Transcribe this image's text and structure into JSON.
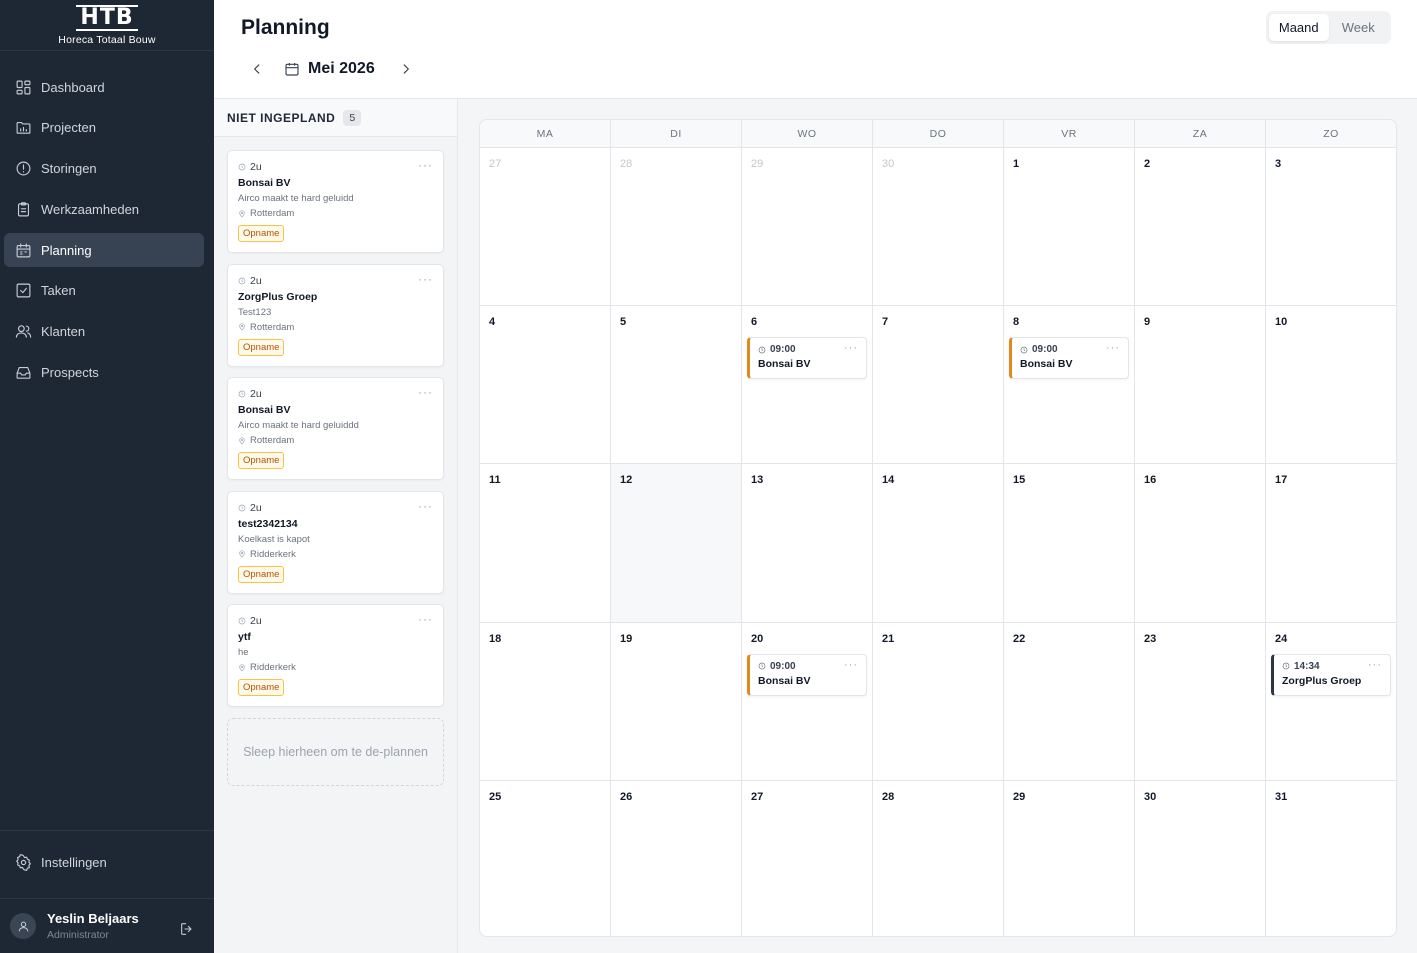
{
  "brand": {
    "mark": "HTB",
    "name": "Horeca Totaal Bouw"
  },
  "sidebar": {
    "items": [
      {
        "label": "Dashboard",
        "icon": "dashboard-icon"
      },
      {
        "label": "Projecten",
        "icon": "folder-chart-icon"
      },
      {
        "label": "Storingen",
        "icon": "alert-circle-icon"
      },
      {
        "label": "Werkzaamheden",
        "icon": "clipboard-icon"
      },
      {
        "label": "Planning",
        "icon": "calendar-icon",
        "active": true
      },
      {
        "label": "Taken",
        "icon": "checkbox-icon"
      },
      {
        "label": "Klanten",
        "icon": "users-icon"
      },
      {
        "label": "Prospects",
        "icon": "inbox-icon"
      }
    ],
    "settings_label": "Instellingen"
  },
  "user": {
    "name": "Yeslin Beljaars",
    "role": "Administrator"
  },
  "header": {
    "title": "Planning",
    "month": "Mei 2026",
    "views": [
      "Maand",
      "Week"
    ],
    "active_view": "Maand"
  },
  "unplanned": {
    "title": "NIET INGEPLAND",
    "count": "5",
    "cards": [
      {
        "duration": "2u",
        "name": "Bonsai BV",
        "description": "Airco maakt te hard geluidd",
        "location": "Rotterdam",
        "badge": "Opname"
      },
      {
        "duration": "2u",
        "name": "ZorgPlus Groep",
        "description": "Test123",
        "location": "Rotterdam",
        "badge": "Opname"
      },
      {
        "duration": "2u",
        "name": "Bonsai BV",
        "description": "Airco maakt te hard geluiddd",
        "location": "Rotterdam",
        "badge": "Opname"
      },
      {
        "duration": "2u",
        "name": "test2342134",
        "description": "Koelkast is kapot",
        "location": "Ridderkerk",
        "badge": "Opname"
      },
      {
        "duration": "2u",
        "name": "ytf",
        "description": "he",
        "location": "Ridderkerk",
        "badge": "Opname"
      }
    ],
    "dropzone": "Sleep hierheen om te de-plannen"
  },
  "calendar": {
    "weekdays": [
      "MA",
      "DI",
      "WO",
      "DO",
      "VR",
      "ZA",
      "ZO"
    ],
    "weeks": [
      [
        {
          "day": "27",
          "outside": true
        },
        {
          "day": "28",
          "outside": true
        },
        {
          "day": "29",
          "outside": true
        },
        {
          "day": "30",
          "outside": true
        },
        {
          "day": "1"
        },
        {
          "day": "2"
        },
        {
          "day": "3"
        }
      ],
      [
        {
          "day": "4"
        },
        {
          "day": "5"
        },
        {
          "day": "6",
          "events": [
            {
              "time": "09:00",
              "name": "Bonsai BV",
              "color": "orange"
            }
          ]
        },
        {
          "day": "7"
        },
        {
          "day": "8",
          "events": [
            {
              "time": "09:00",
              "name": "Bonsai BV",
              "color": "orange"
            }
          ]
        },
        {
          "day": "9"
        },
        {
          "day": "10"
        }
      ],
      [
        {
          "day": "11"
        },
        {
          "day": "12",
          "today": true
        },
        {
          "day": "13"
        },
        {
          "day": "14"
        },
        {
          "day": "15"
        },
        {
          "day": "16"
        },
        {
          "day": "17"
        }
      ],
      [
        {
          "day": "18"
        },
        {
          "day": "19"
        },
        {
          "day": "20",
          "events": [
            {
              "time": "09:00",
              "name": "Bonsai BV",
              "color": "orange"
            }
          ]
        },
        {
          "day": "21"
        },
        {
          "day": "22"
        },
        {
          "day": "23"
        },
        {
          "day": "24",
          "events": [
            {
              "time": "14:34",
              "name": "ZorgPlus Groep",
              "color": "dark"
            }
          ]
        }
      ],
      [
        {
          "day": "25"
        },
        {
          "day": "26"
        },
        {
          "day": "27"
        },
        {
          "day": "28"
        },
        {
          "day": "29"
        },
        {
          "day": "30"
        },
        {
          "day": "31"
        }
      ]
    ]
  },
  "colors": {
    "sidebar_bg": "#1e2835",
    "accent_orange": "#e08a1e",
    "badge_border": "#f5c24d"
  }
}
